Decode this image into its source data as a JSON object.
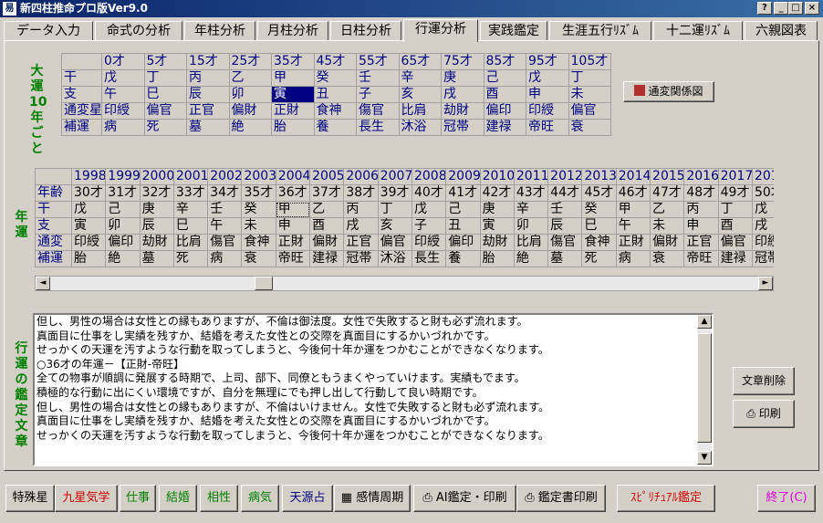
{
  "window": {
    "icon_text": "易",
    "title": "新四柱推命プロ版Ver9.0",
    "help": "?",
    "minimize": "_",
    "maximize": "□",
    "close": "×"
  },
  "tabs": [
    "データ入力",
    "命式の分析",
    "年柱分析",
    "月柱分析",
    "日柱分析",
    "行運分析",
    "実践鑑定",
    "生涯五行ﾘｽﾞﾑ",
    "十二運ﾘｽﾞﾑ",
    "六親図表"
  ],
  "active_tab": 5,
  "taiun": {
    "label": "大運10年ごと",
    "ages": [
      "0才",
      "5才",
      "15才",
      "25才",
      "35才",
      "45才",
      "55才",
      "65才",
      "75才",
      "85才",
      "95才",
      "105才"
    ],
    "rows": [
      {
        "label": "干",
        "cells": [
          "戊",
          "丁",
          "丙",
          "乙",
          "甲",
          "癸",
          "壬",
          "辛",
          "庚",
          "己",
          "戊",
          "丁"
        ]
      },
      {
        "label": "支",
        "cells": [
          "午",
          "巳",
          "辰",
          "卯",
          "寅",
          "丑",
          "子",
          "亥",
          "戌",
          "酉",
          "申",
          "未"
        ]
      },
      {
        "label": "通変星",
        "cells": [
          "印綬",
          "偏官",
          "正官",
          "偏財",
          "正財",
          "食神",
          "傷官",
          "比肩",
          "劫財",
          "偏印",
          "印綬",
          "偏官"
        ]
      },
      {
        "label": "補運",
        "cells": [
          "病",
          "死",
          "墓",
          "絶",
          "胎",
          "養",
          "長生",
          "沐浴",
          "冠帯",
          "建禄",
          "帝旺",
          "衰"
        ]
      }
    ],
    "relation_button": "通変関係図"
  },
  "nenun": {
    "label": "年運",
    "years": [
      "1998",
      "1999",
      "2000",
      "2001",
      "2002",
      "2003",
      "2004",
      "2005",
      "2006",
      "2007",
      "2008",
      "2009",
      "2010",
      "2011",
      "2012",
      "2013",
      "2014",
      "2015",
      "2016",
      "2017",
      "201"
    ],
    "rows": [
      {
        "label": "年齢",
        "cells": [
          "30才",
          "31才",
          "32才",
          "33才",
          "34才",
          "35才",
          "36才",
          "37才",
          "38才",
          "39才",
          "40才",
          "41才",
          "42才",
          "43才",
          "44才",
          "45才",
          "46才",
          "47才",
          "48才",
          "49才",
          "50才"
        ]
      },
      {
        "label": "干",
        "cells": [
          "戊",
          "己",
          "庚",
          "辛",
          "壬",
          "癸",
          "甲",
          "乙",
          "丙",
          "丁",
          "戊",
          "己",
          "庚",
          "辛",
          "壬",
          "癸",
          "甲",
          "乙",
          "丙",
          "丁",
          "戊"
        ]
      },
      {
        "label": "支",
        "cells": [
          "寅",
          "卯",
          "辰",
          "巳",
          "午",
          "未",
          "申",
          "酉",
          "戌",
          "亥",
          "子",
          "丑",
          "寅",
          "卯",
          "辰",
          "巳",
          "午",
          "未",
          "申",
          "酉",
          "戌"
        ]
      },
      {
        "label": "通変",
        "cells": [
          "印綬",
          "偏印",
          "劫財",
          "比肩",
          "傷官",
          "食神",
          "正財",
          "偏財",
          "正官",
          "偏官",
          "印綬",
          "偏印",
          "劫財",
          "比肩",
          "傷官",
          "食神",
          "正財",
          "偏財",
          "正官",
          "偏官",
          "印綬"
        ]
      },
      {
        "label": "補運",
        "cells": [
          "胎",
          "絶",
          "墓",
          "死",
          "病",
          "衰",
          "帝旺",
          "建禄",
          "冠帯",
          "沐浴",
          "長生",
          "養",
          "胎",
          "絶",
          "墓",
          "死",
          "病",
          "衰",
          "帝旺",
          "建禄",
          "冠帯"
        ]
      }
    ],
    "scroll_left": "◄",
    "scroll_right": "►"
  },
  "kantei": {
    "label": "行運の鑑定文章",
    "lines": [
      "但し、男性の場合は女性との縁もありますが、不倫は御法度。女性で失敗すると財も必ず流れます。",
      "真面目に仕事をし実績を残すか、結婚を考えた女性との交際を真面目にするかいづれかです。",
      "せっかくの天運を汚すような行動を取ってしまうと、今後何十年か運をつかむことができなくなります。",
      "○36才の年運－【正財-帝旺】",
      "全ての物事が順調に発展する時期で、上司、部下、同僚ともうまくやっていけます。実績もでます。",
      "積極的な行動に出にくい環境ですが、自分を無理にでも押し出して行動して良い時期です。",
      "但し、男性の場合は女性との縁もありますが、不倫はいけません。女性で失敗すると財も必ず流れます。",
      "真面目に仕事をし実績を残すか、結婚を考えた女性との交際を真面目にするかいづれかです。",
      "せっかくの天運を汚すような行動を取ってしまうと、今後何十年か運をつかむことができなくなります。"
    ],
    "scroll_up": "▲",
    "scroll_down": "▼",
    "delete_button": "文章削除",
    "print_button": "印刷"
  },
  "bottom": {
    "tokushusei": "特殊星",
    "kyusei": "九星気学",
    "shigoto": "仕事",
    "kekkon": "結婚",
    "aisho": "相性",
    "byoki": "病気",
    "tengen": "天源占",
    "kanjo": "感情周期",
    "ai_print": "AI鑑定・印刷",
    "kanteisho": "鑑定書印刷",
    "spiritual": "ｽﾋﾟﾘﾁｭｱﾙ鑑定",
    "exit": "終了(C)"
  },
  "colors": {
    "title_bar": "#0a246a",
    "green_label": "#008000",
    "blue_text": "#000080",
    "red_text": "#d00000",
    "magenta_text": "#e000e0"
  }
}
